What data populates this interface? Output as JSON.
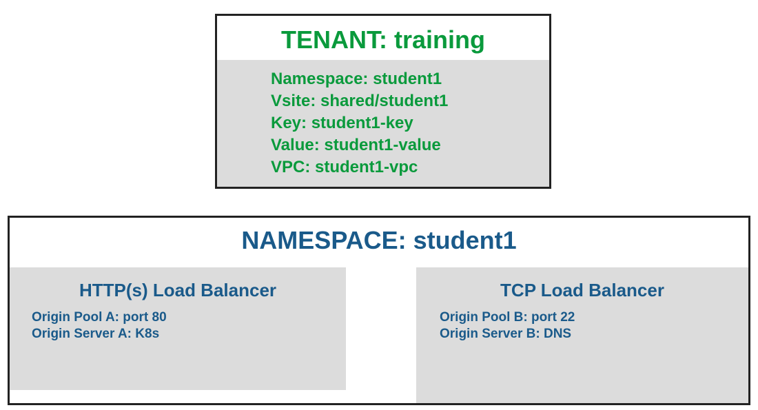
{
  "tenant": {
    "title": "TENANT: training",
    "lines": [
      "Namespace: student1",
      "Vsite: shared/student1",
      "Key: student1-key",
      "Value: student1-value",
      "VPC: student1-vpc"
    ]
  },
  "namespace": {
    "title": "NAMESPACE: student1",
    "http_lb": {
      "title": "HTTP(s) Load Balancer",
      "lines": [
        "Origin Pool A: port 80",
        "Origin Server A: K8s"
      ]
    },
    "tcp_lb": {
      "title": "TCP Load Balancer",
      "lines": [
        "Origin Pool B: port 22",
        "Origin Server B: DNS"
      ]
    }
  },
  "colors": {
    "tenant_text": "#0a9a3c",
    "namespace_text": "#1a5a8a",
    "panel_fill": "#dcdcdc",
    "border": "#222222"
  }
}
